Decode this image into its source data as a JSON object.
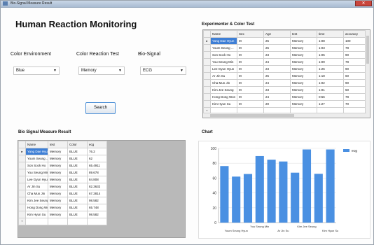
{
  "window": {
    "title": "Bio-Signal Measure Result"
  },
  "app_title": "Human Reaction Monitoring",
  "filters": {
    "color_environment": {
      "label": "Color Environment",
      "value": "Blue"
    },
    "color_reaction_test": {
      "label": "Color Reaction Test",
      "value": "Memory"
    },
    "bio_signal": {
      "label": "Bio-Signal",
      "value": "ECG"
    }
  },
  "search_label": "Search",
  "experimenter": {
    "title": "Experimenter & Color Test",
    "columns": [
      "Name",
      "Sex",
      "Age",
      "test",
      "time",
      "accuracy"
    ],
    "rows": [
      [
        "Yang Dae Hyun",
        "M",
        "25",
        "Memory",
        "1:08",
        "100"
      ],
      [
        "Youm Seung ...",
        "M",
        "25",
        "Memory",
        "1:03",
        "78"
      ],
      [
        "Son Sock Ho",
        "M",
        "23",
        "Memory",
        "1:05",
        "90"
      ],
      [
        "You Seung Min",
        "M",
        "24",
        "Memory",
        "1:09",
        "78"
      ],
      [
        "Lee Gyun Hyun",
        "M",
        "23",
        "Memory",
        "1:26",
        "90"
      ],
      [
        "Ar Jin Su",
        "M",
        "25",
        "Memory",
        "1:18",
        "60"
      ],
      [
        "Cha Mun Jin",
        "M",
        "24",
        "Memory",
        "1:02",
        "90"
      ],
      [
        "Kim Jee Seung",
        "M",
        "23",
        "Memory",
        "1:01",
        "50"
      ],
      [
        "Hong Dong Won",
        "M",
        "24",
        "Memory",
        "0:56",
        "78"
      ],
      [
        "Kim Hyun Su",
        "M",
        "20",
        "Memory",
        "1:27",
        "70"
      ]
    ]
  },
  "biosignal": {
    "title": "Bio Signal Measure Result",
    "columns": [
      "Name",
      "test",
      "Color",
      "ecg"
    ],
    "rows": [
      [
        "Yang Dae Hyun",
        "Memory",
        "BLUE",
        "76.2"
      ],
      [
        "Youm Seung ...",
        "Memory",
        "BLUE",
        "62"
      ],
      [
        "Son Sock Ho",
        "Memory",
        "BLUE",
        "65.4911"
      ],
      [
        "You Seung Min",
        "Memory",
        "BLUE",
        "89.678"
      ],
      [
        "Lee Gyun Hyun",
        "Memory",
        "BLUE",
        "84.808"
      ],
      [
        "Ar Jin Su",
        "Memory",
        "BLUE",
        "82.3632"
      ],
      [
        "Cha Mun Jin",
        "Memory",
        "BLUE",
        "67.2814"
      ],
      [
        "Kim Jee Seung",
        "Memory",
        "BLUE",
        "98.582"
      ],
      [
        "Hong Dong Won",
        "Memory",
        "BLUE",
        "65.748"
      ],
      [
        "Kim Hyun Su",
        "Memory",
        "BLUE",
        "98.582"
      ]
    ]
  },
  "chart_title": "Chart",
  "chart_data": {
    "type": "bar",
    "categories": [
      "Yang Dae Hyun",
      "Youm Seung Hyun",
      "Son Sock Ho",
      "You Seung Min",
      "Lee Gyun Hyun",
      "Ar Jin Su",
      "Cha Mun Jin",
      "Kim Jee Seung",
      "Hong Dong Won",
      "Kim Hyun Su"
    ],
    "tick_labels": [
      "",
      "Youm Seung Hyun",
      "",
      "You Seung Min",
      "",
      "Ar Jin Su",
      "",
      "Kim Jee Seung",
      "",
      "Kim Hyun Su"
    ],
    "series": [
      {
        "name": "ecg",
        "values": [
          76.2,
          62,
          65.49,
          89.68,
          84.81,
          82.36,
          67.28,
          98.58,
          65.75,
          98.58
        ]
      }
    ],
    "yticks": [
      0,
      20,
      40,
      60,
      80,
      100
    ],
    "ylim": [
      0,
      100
    ],
    "grid": true,
    "legend": "top-right",
    "bar_color": "#4a90e2"
  }
}
